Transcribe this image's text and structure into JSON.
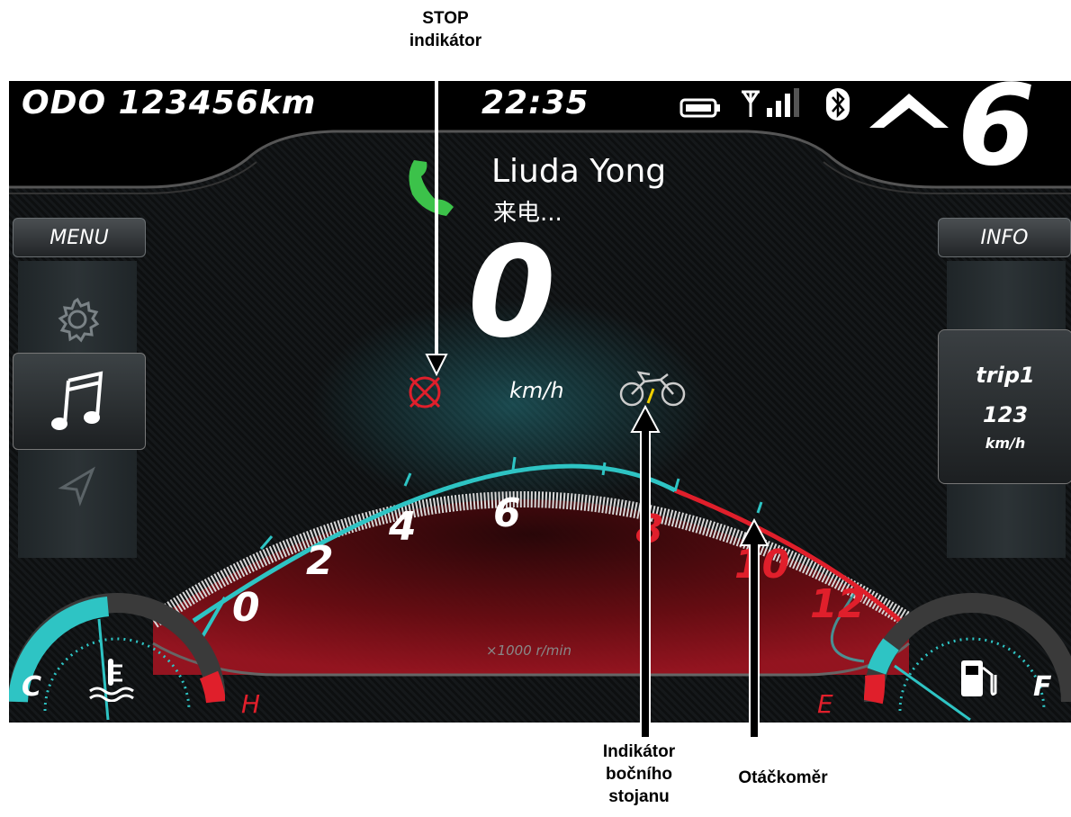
{
  "callouts": {
    "stop": [
      "STOP",
      "indikátor"
    ],
    "sidestand": [
      "Indikátor",
      "bočního",
      "stojanu"
    ],
    "tachometer": "Otáčkoměr"
  },
  "status_bar": {
    "odometer": "ODO 123456km",
    "clock": "22:35",
    "gear": "6",
    "icons": [
      "battery-icon",
      "signal-icon",
      "bluetooth-icon",
      "shift-up-icon"
    ]
  },
  "call": {
    "caller": "Liuda Yong",
    "status": "来电...",
    "icon": "phone-icon"
  },
  "left_panel": {
    "menu_label": "MENU",
    "items": [
      {
        "name": "settings",
        "icon": "gear-icon",
        "active": false
      },
      {
        "name": "music",
        "icon": "music-note-icon",
        "active": true
      },
      {
        "name": "navigation",
        "icon": "navigation-arrow-icon",
        "active": false
      }
    ]
  },
  "right_panel": {
    "info_label": "INFO",
    "trip": {
      "label": "trip1",
      "value": "123",
      "unit": "km/h"
    }
  },
  "speed": {
    "value": "0",
    "unit": "km/h"
  },
  "indicators": {
    "stop": "stop-icon",
    "sidestand": "motorcycle-sidestand-icon"
  },
  "tachometer": {
    "ticks": [
      "0",
      "2",
      "4",
      "6",
      "8",
      "10",
      "12"
    ],
    "unit": "×1000 r/min"
  },
  "temp_gauge": {
    "min_label": "C",
    "max_label": "H",
    "icon": "coolant-temperature-icon"
  },
  "fuel_gauge": {
    "min_label": "E",
    "max_label": "F",
    "icon": "fuel-pump-icon"
  },
  "colors": {
    "accent": "#2ec4c4",
    "redline": "#e01f2b",
    "call_green": "#3cc24a"
  }
}
